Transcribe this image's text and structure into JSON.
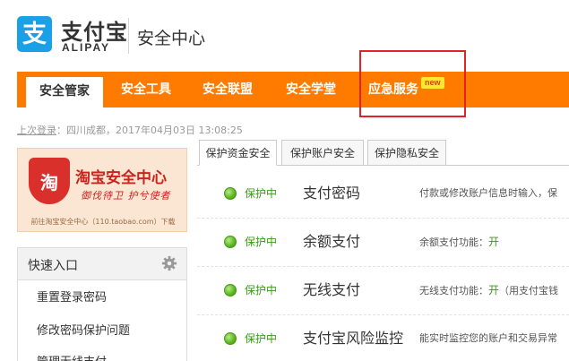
{
  "header": {
    "logo_glyph": "支",
    "brand_cn": "支付宝",
    "brand_en": "ALIPAY",
    "site_title": "安全中心"
  },
  "nav": {
    "items": [
      {
        "label": "安全管家"
      },
      {
        "label": "安全工具"
      },
      {
        "label": "安全联盟"
      },
      {
        "label": "安全学堂"
      },
      {
        "label": "应急服务"
      }
    ],
    "new_badge": "new",
    "active_index": 0
  },
  "last_login": {
    "label": "上次登录",
    "text": "：四川成都，2017年04月03日 13:08:25"
  },
  "banner": {
    "shield_glyph": "淘",
    "title": "淘宝安全中心",
    "slogan": "御伐待卫  护兮使者",
    "footer": "前往淘宝安全中心（110.taobao.com）下载"
  },
  "quick_links": {
    "title": "快速入口",
    "items": [
      "重置登录密码",
      "修改密码保护问题",
      "管理无线支付"
    ]
  },
  "tabs": [
    "保护资金安全",
    "保护账户安全",
    "保护隐私安全"
  ],
  "rows": [
    {
      "status": "保护中",
      "feature": "支付密码",
      "desc": "付款或修改账户信息时输入，保",
      "desc_on": ""
    },
    {
      "status": "保护中",
      "feature": "余额支付",
      "desc": "余额支付功能：",
      "desc_on": "开"
    },
    {
      "status": "保护中",
      "feature": "无线支付",
      "desc": "无线支付功能：",
      "desc_on": "开",
      "desc_after": "（用支付宝钱"
    },
    {
      "status": "保护中",
      "feature": "支付宝风险监控",
      "desc": "能实时监控您的账户和交易异常",
      "desc_on": ""
    }
  ],
  "colors": {
    "nav_orange": "#fe7b00",
    "brand_blue": "#1aa0e6",
    "status_green": "#3a9a1a",
    "highlight_red": "#e02329"
  },
  "icons": {
    "logo": "alipay-logo-icon",
    "settings": "gear-icon",
    "status": "green-dot-icon",
    "banner": "shield-icon"
  }
}
